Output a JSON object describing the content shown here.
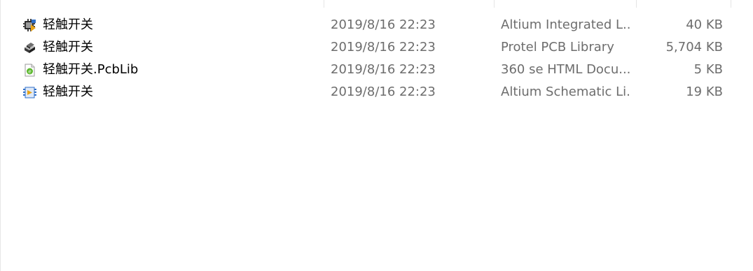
{
  "header": {
    "sort_indicator": "^"
  },
  "files": [
    {
      "name": "轻触开关",
      "modified": "2019/8/16 22:23",
      "type": "Altium Integrated L...",
      "size": "40 KB",
      "icon": "altium-integrated-library-icon"
    },
    {
      "name": "轻触开关",
      "modified": "2019/8/16 22:23",
      "type": "Protel PCB Library",
      "size": "5,704 KB",
      "icon": "pcb-library-icon"
    },
    {
      "name": "轻触开关.PcbLib",
      "modified": "2019/8/16 22:23",
      "type": "360 se HTML Docu...",
      "size": "5 KB",
      "icon": "html-document-icon"
    },
    {
      "name": "轻触开关",
      "modified": "2019/8/16 22:23",
      "type": "Altium Schematic Li...",
      "size": "19 KB",
      "icon": "schematic-library-icon"
    }
  ],
  "colors": {
    "name_text": "#000000",
    "detail_text": "#6d6d6d",
    "separator": "#e5e5e5"
  }
}
